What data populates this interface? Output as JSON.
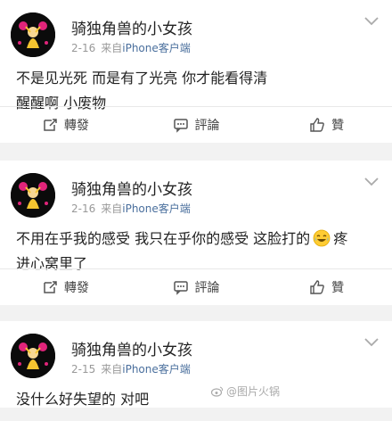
{
  "posts": [
    {
      "username": "骑独角兽的小女孩",
      "date": "2-16",
      "from": "来自",
      "source": "iPhone客户端",
      "lines": [
        "不是见光死 而是有了光亮 你才能看得清",
        "醒醒啊 小废物"
      ],
      "actions": {
        "repost": "轉發",
        "comment": "評論",
        "like": "贊"
      }
    },
    {
      "username": "骑独角兽的小女孩",
      "date": "2-16",
      "from": "来自",
      "source": "iPhone客户端",
      "line1_before": "不用在乎我的感受 我只在乎你的感受 这脸打的",
      "line1_after": "疼",
      "line2": "进心窝里了",
      "emoji": "laughing-crying-emoji",
      "actions": {
        "repost": "轉發",
        "comment": "評論",
        "like": "贊"
      }
    },
    {
      "username": "骑独角兽的小女孩",
      "date": "2-15",
      "from": "来自",
      "source": "iPhone客户端",
      "lines": [
        "没什么好失望的 对吧"
      ],
      "watermark": "@图片火锅"
    }
  ],
  "colors": {
    "source_link": "#4a6f9d",
    "meta": "#999999",
    "background": "#f2f2f2"
  },
  "icons": [
    "chevron-down-icon",
    "repost-icon",
    "comment-icon",
    "like-icon",
    "weibo-logo-icon"
  ]
}
